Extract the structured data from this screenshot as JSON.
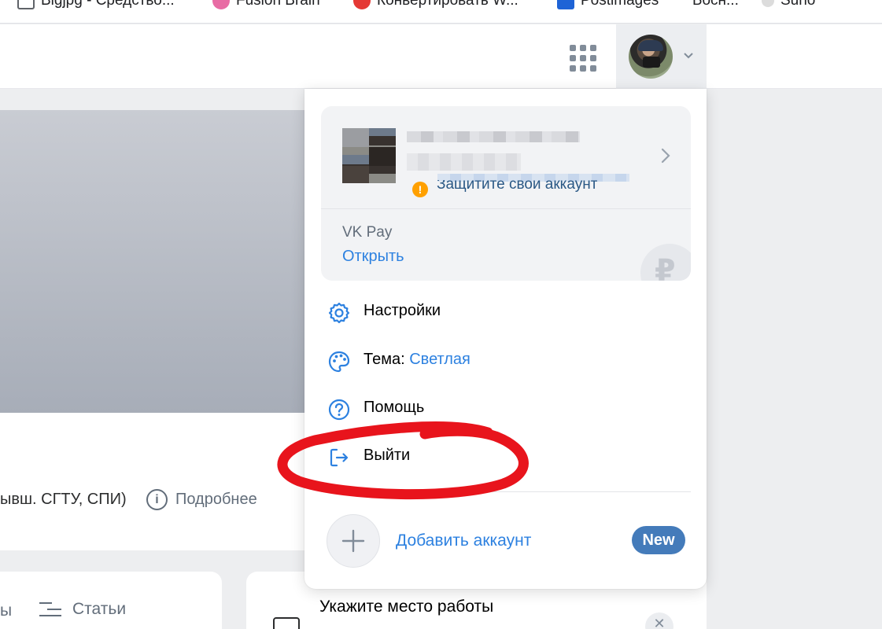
{
  "browser": {
    "bookmarks": [
      {
        "label": "Bigjpg - Средство...",
        "icon": "bigjpg-icon"
      },
      {
        "label": "Fusion Brain",
        "icon": "fusion-brain-icon"
      },
      {
        "label": "Конвертировать W...",
        "icon": "convert-icon"
      },
      {
        "label": "Postimages",
        "icon": "postimages-icon"
      },
      {
        "label": "Босн...",
        "icon": "blank-icon"
      },
      {
        "label": "Suno",
        "icon": "suno-icon"
      }
    ]
  },
  "header": {
    "apps_icon": "grid-icon",
    "profile_icon": "avatar",
    "chevron_icon": "chevron-down-icon"
  },
  "page": {
    "education": "ывш. СГТУ, СПИ)",
    "details": "Подробнее",
    "tab_prev": "ы",
    "articles": "Статьи",
    "work_prompt": "Укажите место работы"
  },
  "dropdown": {
    "account": {
      "protect": "Защитите свой аккаунт"
    },
    "vkpay": {
      "label": "VK Pay",
      "action": "Открыть",
      "currency_symbol": "₽"
    },
    "menu": {
      "settings": "Настройки",
      "theme_label": "Тема:",
      "theme_value": "Светлая",
      "help": "Помощь",
      "logout": "Выйти"
    },
    "add_account": "Добавить аккаунт",
    "new_badge": "New"
  },
  "colors": {
    "accent": "#2d81e0",
    "badge": "#447bba",
    "annotation": "#e8141c",
    "warning": "#ffa000"
  }
}
